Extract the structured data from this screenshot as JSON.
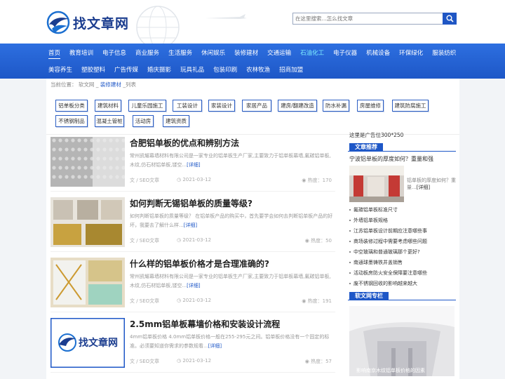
{
  "brand": {
    "name": "找文章网"
  },
  "search": {
    "placeholder": "在这里搜索...怎么找文章"
  },
  "nav": {
    "row1": [
      "首页",
      "教育培训",
      "电子信息",
      "商业服务",
      "生活服务",
      "休闲娱乐",
      "装修建材",
      "交通运输",
      "石油化工",
      "电子仪器",
      "机械设备",
      "环保绿化",
      "服装纺织"
    ],
    "row2": [
      "美容养生",
      "塑胶塑料",
      "广告传媒",
      "婚庆摄影",
      "玩具礼品",
      "包装印刷",
      "农林牧渔",
      "招商加盟"
    ]
  },
  "breadcrumb": {
    "prefix": "当前位置：",
    "home": "软文网",
    "sep": "_",
    "current": "装修建材",
    "suffix": "_列表"
  },
  "tags": [
    "铝单板分类",
    "建筑材料",
    "儿童乐园施工",
    "工装设计",
    "家装设计",
    "家居产品",
    "建房/翻建改造",
    "防水补漏",
    "房屋维修",
    "建筑防腐施工",
    "不锈钢制品",
    "混凝土管桩",
    "活动房",
    "建筑资质"
  ],
  "articles": [
    {
      "title": "合肥铝单板的优点和辨别方法",
      "desc": "常州凯耀幕墙材料有限公司是一家专业的铝单板生产厂家,主要致力于铝单板幕墙,氟碳铝单板,木纹,仿石材铝单板,镂空...",
      "more": "[详细]",
      "author": "文 / SEO文章",
      "date": "2021-03-12",
      "hot": "热度：170"
    },
    {
      "title": "如何判断无锡铝单板的质量等级?",
      "desc": "如何判断铝单板的质量等级？ 在铝单板产品的购买中，首先要学会如何去判断铝单板产品的好坏，我要去了解什么样...",
      "more": "[详细]",
      "author": "文 / SEO文章",
      "date": "2021-03-12",
      "hot": "热度：50"
    },
    {
      "title": "什么样的铝单板价格才是合理准确的?",
      "desc": "常州凯耀幕墙材料有限公司是一家专业的铝单板生产厂家,主要致力于铝单板幕墙,氟碳铝单板,木纹,仿石材铝单板,镂空...",
      "more": "[详细]",
      "author": "文 / SEO文章",
      "date": "2021-03-12",
      "hot": "热度：191"
    },
    {
      "title": "2.5mm铝单板幕墙价格和安装设计流程",
      "desc": "4mm铝单板价格 4.0mm铝单板价格一般在255-295元之间。铝单板价格没有一个固定的标准。必须要知道你需求的参数规看...",
      "more": "[详细]",
      "author": "文 / SEO文章",
      "date": "2021-03-12",
      "hot": "热度：57"
    }
  ],
  "sidebar": {
    "ad_text": "这里是广告位300*250",
    "recommend_title": "文章推荐",
    "featured_title": "宁波铝单板的厚度如何？重量和强",
    "featured_desc": "铝单板的厚度如何？重量...",
    "featured_more": "[详细]",
    "list": [
      "氟碳铝单板标准尺寸",
      "外墙铝单板规格",
      "江苏铝单板设计前期应注意哪些事",
      "商场装修过程中需要考虑哪些问题",
      "中空玻璃和普通玻璃那个更好?",
      "南通球墨铸铁井盖销售",
      "活动板房防火安全保障要注意哪些",
      "废不锈钢回收的影响越来越大"
    ],
    "column_title": "软文网专栏",
    "column_caption": "影响南京木纹铝单板价格的因素"
  },
  "colors": {
    "brand_blue": "#1e57c7",
    "nav_highlight": "#7ff0ff"
  }
}
